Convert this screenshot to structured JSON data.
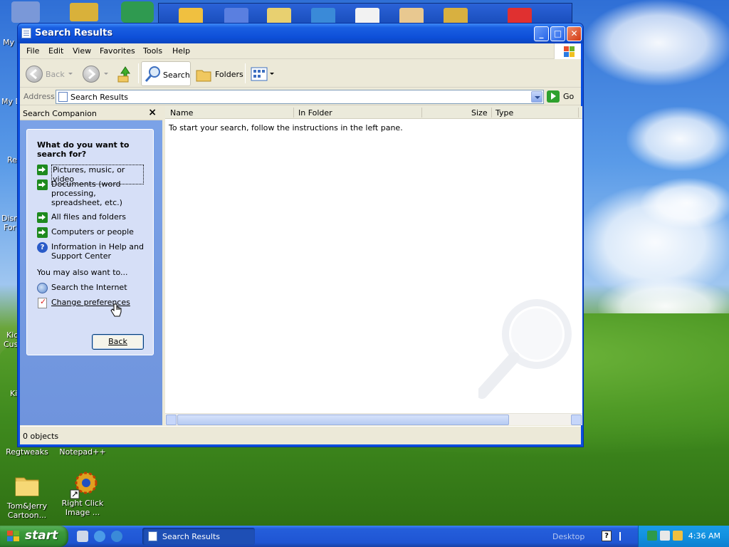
{
  "desktop": {
    "icons": [
      {
        "label": "Regtweaks"
      },
      {
        "label": "Notepad++"
      },
      {
        "label": "Tom&Jerry Cartoon..."
      },
      {
        "label": "Right Click Image ..."
      }
    ],
    "edge_labels": [
      "My",
      "My D",
      "Re",
      "Disn",
      "For",
      "Kic",
      "Cus",
      "Ki"
    ]
  },
  "window": {
    "title": "Search Results",
    "menu": [
      "File",
      "Edit",
      "View",
      "Favorites",
      "Tools",
      "Help"
    ],
    "toolbar": {
      "back": "Back",
      "search": "Search",
      "folders": "Folders"
    },
    "address": {
      "label": "Address",
      "value": "Search Results",
      "go": "Go"
    },
    "companion": {
      "title": "Search Companion",
      "close": "×",
      "question": "What do you want to search for?",
      "options": [
        "Pictures, music, or video",
        "Documents (word processing, spreadsheet, etc.)",
        "All files and folders",
        "Computers or people",
        "Information in Help and Support Center"
      ],
      "also_label": "You may also want to...",
      "also_options": [
        "Search the Internet",
        "Change preferences"
      ],
      "back_button": "Back"
    },
    "columns": [
      "Name",
      "In Folder",
      "Size",
      "Type"
    ],
    "empty_message": "To start your search, follow the instructions in the left pane.",
    "status": "0 objects"
  },
  "taskbar": {
    "start": "start",
    "task": "Search Results",
    "desktop_label": "Desktop",
    "clock": "4:36 AM"
  }
}
